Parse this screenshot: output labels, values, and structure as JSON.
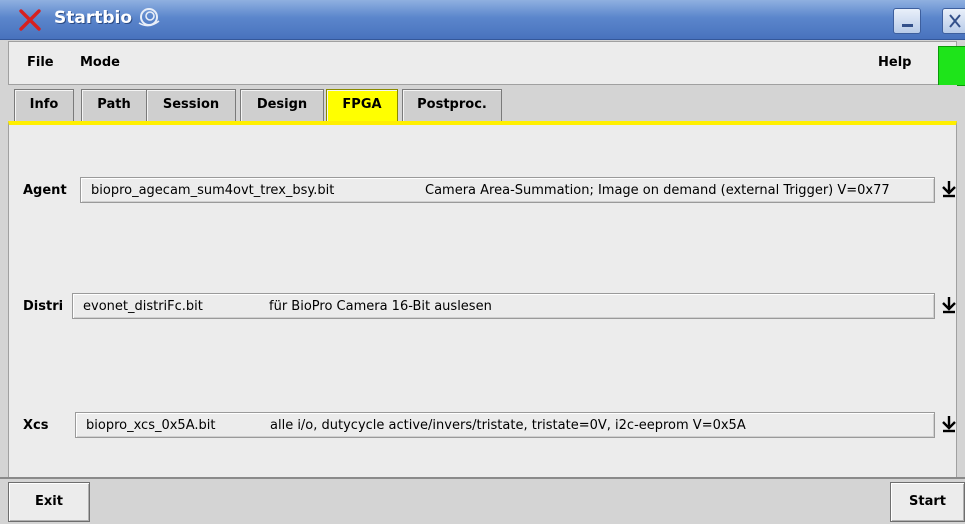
{
  "window": {
    "title": "Startbio",
    "icons": [
      "close-x-app-icon",
      "swirl-logo-icon",
      "minimize-icon",
      "close-icon"
    ]
  },
  "menu": {
    "file": "File",
    "mode": "Mode",
    "help": "Help",
    "status_color": "#1ee41a"
  },
  "tabs": [
    {
      "label": "Info",
      "active": false
    },
    {
      "label": "Path",
      "active": false
    },
    {
      "label": "Session",
      "active": false
    },
    {
      "label": "Design",
      "active": false
    },
    {
      "label": "FPGA",
      "active": true
    },
    {
      "label": "Postproc.",
      "active": false
    }
  ],
  "fpga": {
    "agent": {
      "label": "Agent",
      "file": "biopro_agecam_sum4ovt_trex_bsy.bit",
      "description": "Camera Area-Summation; Image on demand (external Trigger) V=0x77"
    },
    "distri": {
      "label": "Distri",
      "file": "evonet_distriFc.bit",
      "description": "für BioPro Camera 16-Bit auslesen"
    },
    "xcs": {
      "label": "Xcs",
      "file": "biopro_xcs_0x5A.bit",
      "description": "alle i/o, dutycycle active/invers/tristate, tristate=0V, i2c-eeprom V=0x5A"
    }
  },
  "buttons": {
    "exit": "Exit",
    "start": "Start"
  },
  "colors": {
    "active_tab": "#ffff00",
    "titlebar": "#5b86cc"
  }
}
